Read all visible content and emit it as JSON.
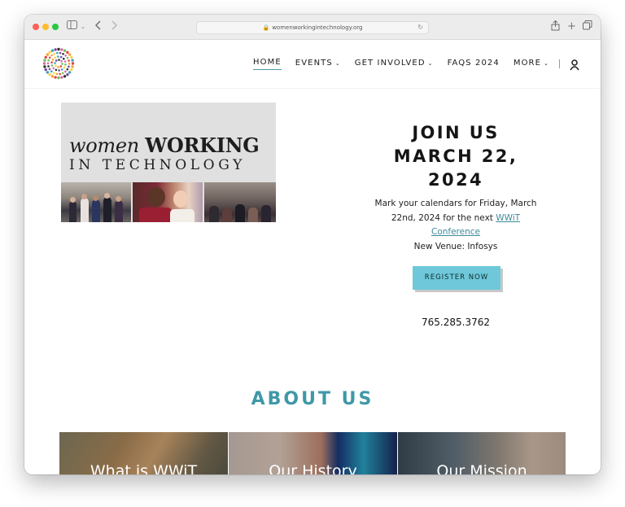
{
  "browser": {
    "url": "womenworkingintechnology.org"
  },
  "nav": {
    "items": [
      {
        "label": "HOME",
        "active": true,
        "dropdown": false
      },
      {
        "label": "EVENTS",
        "active": false,
        "dropdown": true
      },
      {
        "label": "GET INVOLVED",
        "active": false,
        "dropdown": true
      },
      {
        "label": "FAQS 2024",
        "active": false,
        "dropdown": false
      },
      {
        "label": "MORE",
        "active": false,
        "dropdown": true
      }
    ],
    "account_icon": "user-icon"
  },
  "hero": {
    "image_title_italic": "women",
    "image_title_caps": "WORKING",
    "image_subtitle": "IN TECHNOLOGY",
    "headline_lines": [
      "JOIN US",
      "MARCH 22,",
      "2024"
    ],
    "description_prefix": "Mark your calendars for Friday, March 22nd, 2024 for the next ",
    "description_link": "WWiT Conference",
    "venue": "New Venue:  Infosys",
    "register_label": "REGISTER NOW",
    "phone": "765.285.3762"
  },
  "about": {
    "heading": "ABOUT US",
    "cards": [
      {
        "title": "What is WWiT"
      },
      {
        "title": "Our History"
      },
      {
        "title": "Our Mission"
      }
    ]
  },
  "colors": {
    "accent": "#3f98a8",
    "button": "#6ec8d9",
    "link": "#3f8a9b"
  }
}
